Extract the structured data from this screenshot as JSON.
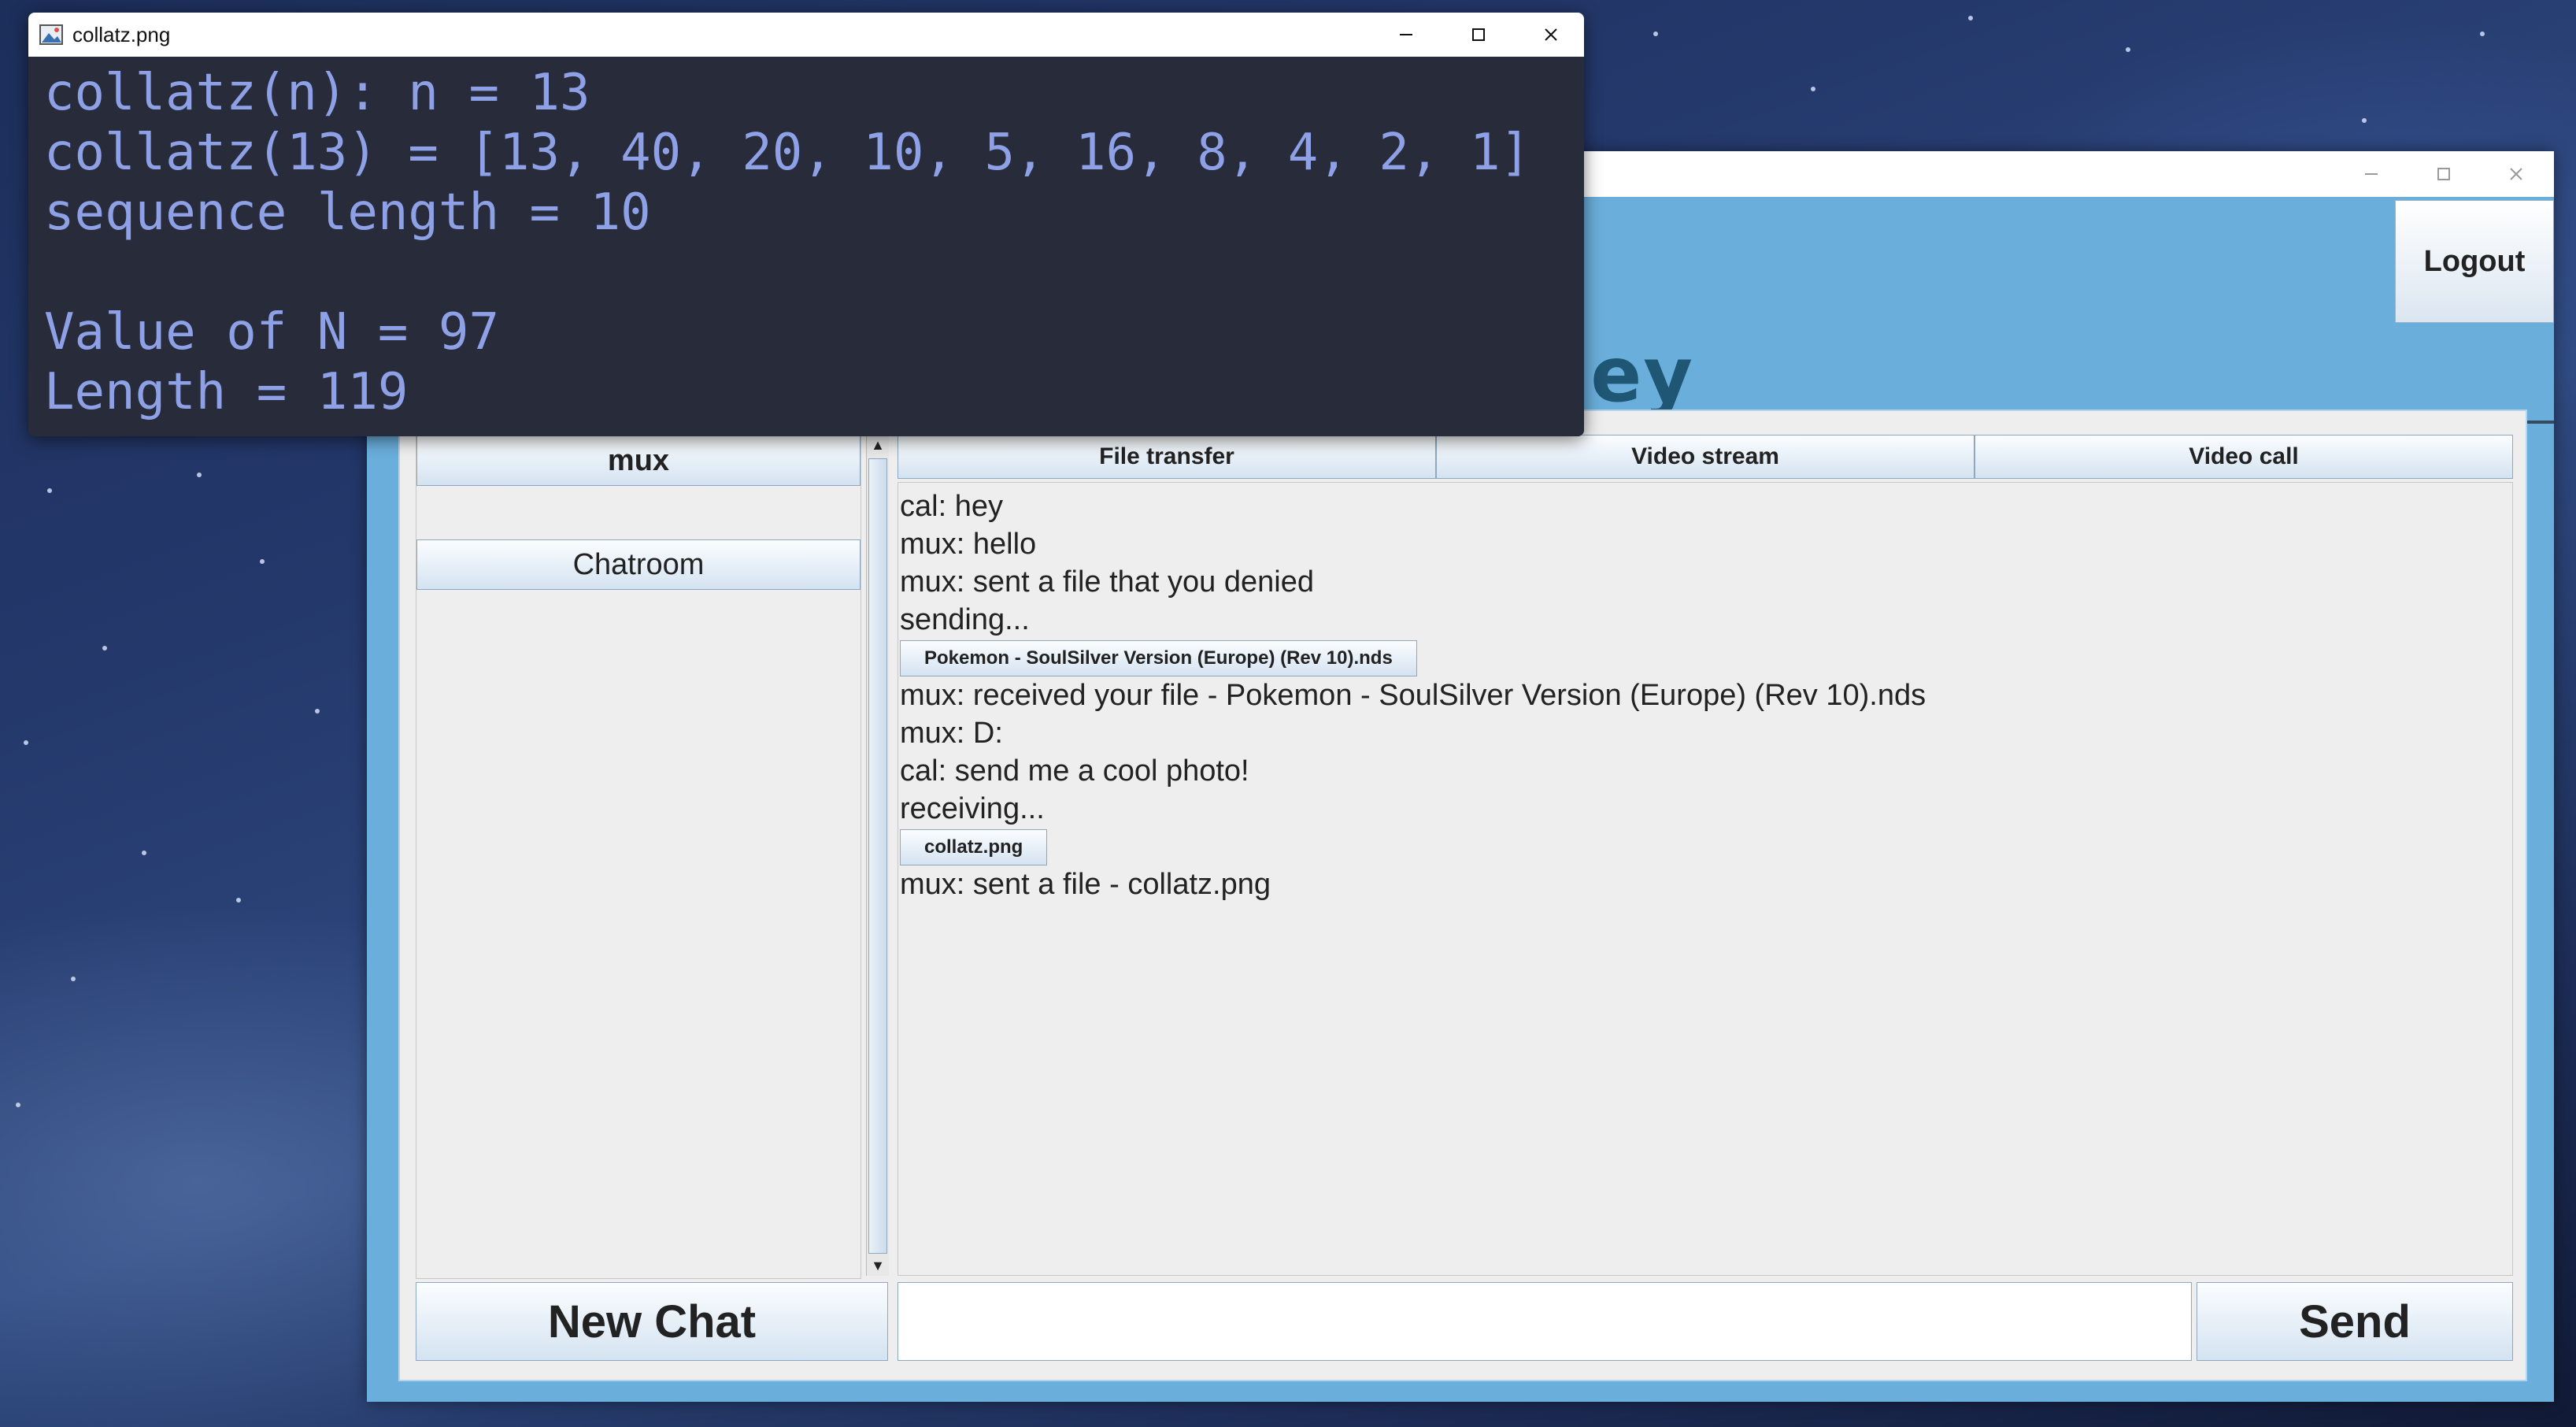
{
  "viewer": {
    "title": "collatz.png",
    "lines": [
      "collatz(n): n = 13",
      "collatz(13) = [13, 40, 20, 10, 5, 16, 8, 4, 2, 1]",
      "sequence length = 10",
      "",
      "Value of N = 97",
      "Length = 119"
    ]
  },
  "chat_app": {
    "brand_visible": "rley",
    "logout_label": "Logout",
    "chat_list": [
      "mux",
      "Chatroom"
    ],
    "new_chat_label": "New Chat",
    "tabs": [
      "File transfer",
      "Video stream",
      "Video call"
    ],
    "messages": [
      {
        "type": "text",
        "text": "cal: hey"
      },
      {
        "type": "text",
        "text": "mux: hello"
      },
      {
        "type": "text",
        "text": "mux: sent a file that you denied"
      },
      {
        "type": "text",
        "text": "sending..."
      },
      {
        "type": "file",
        "text": "Pokemon - SoulSilver Version (Europe) (Rev 10).nds"
      },
      {
        "type": "text",
        "text": "mux: received your file - Pokemon - SoulSilver Version (Europe) (Rev 10).nds"
      },
      {
        "type": "text",
        "text": "mux: D:"
      },
      {
        "type": "text",
        "text": "cal: send me a cool photo!"
      },
      {
        "type": "text",
        "text": "receiving..."
      },
      {
        "type": "file",
        "text": "collatz.png"
      },
      {
        "type": "text",
        "text": "mux: sent a file - collatz.png"
      }
    ],
    "message_input_value": "",
    "send_label": "Send"
  },
  "icons": {
    "minimize": "minimize-icon",
    "maximize": "maximize-icon",
    "close": "close-icon",
    "scroll_up": "arrow-up-icon",
    "scroll_down": "arrow-down-icon",
    "app": "image-viewer-app-icon"
  }
}
